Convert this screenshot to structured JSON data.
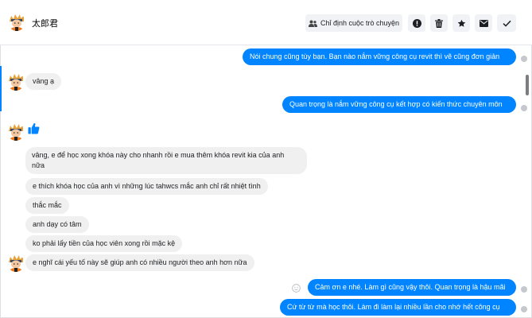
{
  "conversation": {
    "contact_name": "太郎君",
    "assign_label": "Chỉ định cuộc trò chuyện",
    "like_icon": "thumbs-up-icon"
  },
  "messages": [
    {
      "side": "out",
      "text": "Nói chung cũng tùy bạn. Bạn nào nắm vững công cụ revit thì vẽ cũng đơn giản"
    },
    {
      "side": "in",
      "text": "vâng ạ"
    },
    {
      "side": "out",
      "text": "Quan trọng là nắm vững công cụ kết hợp có kiến thức chuyên môn"
    },
    {
      "side": "in",
      "text_line1": "vâng, e để học xong khóa này cho nhanh rồi e mua thêm khóa revit kia của anh",
      "text_line2": "nữa"
    },
    {
      "side": "in",
      "text": "e thích khóa học của anh vì những lúc tahwcs mắc anh chỉ rất nhiệt tình"
    },
    {
      "side": "in",
      "text": "thắc mắc"
    },
    {
      "side": "in",
      "text": "anh dạy có tâm"
    },
    {
      "side": "in",
      "text": "ko phải lấy tiền của học viên xong rồi mặc kệ"
    },
    {
      "side": "in",
      "text": "e nghĩ cái yếu tố này sẽ giúp anh có nhiều người theo anh hơn nữa"
    },
    {
      "side": "out",
      "text": "Cảm ơn e nhé. Làm gì cũng vậy thôi. Quan trọng là hậu mãi"
    },
    {
      "side": "out",
      "text": "Cứ từ từ mà học thôi. Làm đi làm lại nhiều lần cho nhớ hết công cụ"
    }
  ],
  "colors": {
    "accent": "#0084ff",
    "incoming_bubble": "#f1f0f0"
  }
}
